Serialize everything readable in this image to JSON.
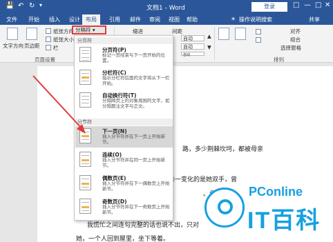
{
  "titlebar": {
    "save_icon": "save-icon",
    "undo_icon": "undo-icon",
    "redo_icon": "redo-icon",
    "title": "文档1 - Word",
    "login": "登录",
    "signin_label": "登录"
  },
  "tabs": [
    "文件",
    "开始",
    "插入",
    "设计",
    "布局",
    "引用",
    "邮件",
    "审阅",
    "视图",
    "帮助"
  ],
  "tell_me": "操作说明搜索",
  "share": "共享",
  "ribbon": {
    "text_direction": "文字方向",
    "margins": "页边距",
    "orientation": "纸张方向",
    "size": "纸张大小",
    "columns": "栏",
    "breaks": "分隔符",
    "indent": "缩进",
    "spacing": "间距",
    "indent_left_value": "",
    "spacing_before": "自动",
    "spacing_after": "自动",
    "spacing_third": "自动",
    "group_page_setup": "页面设置",
    "group_arrange": "排列",
    "align": "对齐",
    "group": "组合",
    "selection_pane": "选择窗格"
  },
  "menu": {
    "section_page_breaks": "分页符",
    "section_section_breaks": "分节符",
    "items": [
      {
        "title": "分页符(P)",
        "desc": "标记一页结束与下一页开始的位置。"
      },
      {
        "title": "分栏符(C)",
        "desc": "指示分栏符后面的文字将从下一栏开始。"
      },
      {
        "title": "自动换行符(T)",
        "desc": "分隔网页上的对象周围的文字，如分隔题注文字与正文。"
      },
      {
        "title": "下一页(N)",
        "desc": "插入分节符并在下一页上开始新节。"
      },
      {
        "title": "连续(O)",
        "desc": "插入分节符并在同一页上开始新节。"
      },
      {
        "title": "偶数页(E)",
        "desc": "插入分节符并在下一偶数页上开始新节。"
      },
      {
        "title": "奇数页(D)",
        "desc": "插入分节符并在下一奇数页上开始新节。"
      }
    ]
  },
  "document": {
    "line1": "路，多少荆棘坎坷，都被母亲",
    "line2": "面，唯一变化的是她双手，曾",
    "line3": "。母亲突然",
    "line4": "我慌忙之间连句完整的话也说不出，只对",
    "line5": "她，一个人回到屋里，坐下等着。"
  },
  "watermark": {
    "brand": "PConline",
    "name": "IT百科"
  },
  "colors": {
    "title_bar": "#2b579a",
    "highlight_box": "#e03b3b",
    "watermark": "#16a0e0"
  }
}
